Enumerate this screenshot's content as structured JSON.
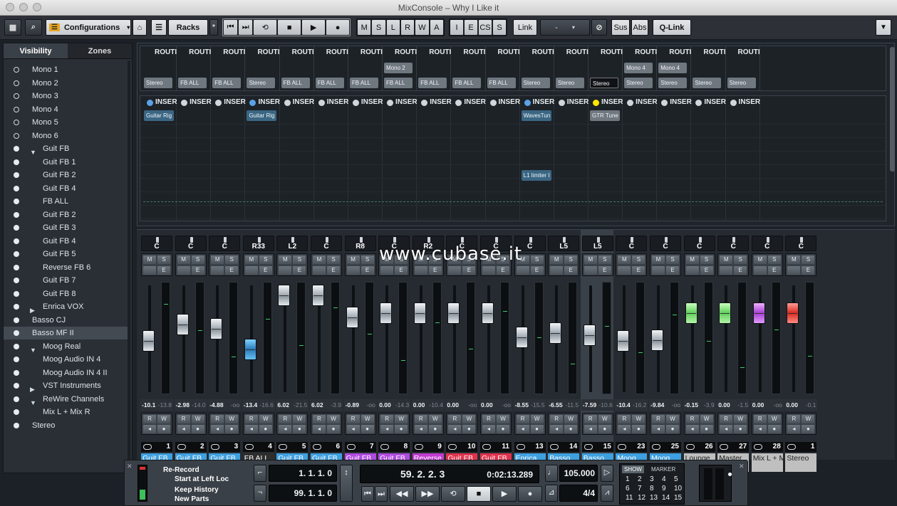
{
  "window": {
    "title": "MixConsole – Why I Like it"
  },
  "toolbar": {
    "configurations_label": "Configurations",
    "racks_label": "Racks",
    "racks_star": "*",
    "msl_keys": [
      "M",
      "S",
      "L",
      "R",
      "W",
      "A"
    ],
    "iecs_keys": [
      "I",
      "E",
      "CS",
      "S"
    ],
    "link_label": "Link",
    "link_value": "-",
    "sus_label": "Sus",
    "abs_label": "Abs",
    "qlink_label": "Q-Link"
  },
  "sidebar": {
    "tabs": [
      "Visibility",
      "Zones"
    ],
    "items": [
      {
        "label": "Mono 1",
        "level": 0,
        "dot": "empty",
        "tri": ""
      },
      {
        "label": "Mono 2",
        "level": 0,
        "dot": "empty",
        "tri": ""
      },
      {
        "label": "Mono 3",
        "level": 0,
        "dot": "empty",
        "tri": ""
      },
      {
        "label": "Mono 4",
        "level": 0,
        "dot": "empty",
        "tri": ""
      },
      {
        "label": "Mono 5",
        "level": 0,
        "dot": "empty",
        "tri": ""
      },
      {
        "label": "Mono 6",
        "level": 0,
        "dot": "empty",
        "tri": ""
      },
      {
        "label": "Guit FB",
        "level": 1,
        "dot": "filled",
        "tri": "open"
      },
      {
        "label": "Guit FB 1",
        "level": 2,
        "dot": "filled",
        "tri": ""
      },
      {
        "label": "Guit FB 2",
        "level": 2,
        "dot": "filled",
        "tri": ""
      },
      {
        "label": "Guit FB 4",
        "level": 2,
        "dot": "filled",
        "tri": ""
      },
      {
        "label": "FB ALL",
        "level": 2,
        "dot": "filled",
        "tri": ""
      },
      {
        "label": "Guit FB 2",
        "level": 2,
        "dot": "filled",
        "tri": ""
      },
      {
        "label": "Guit FB 3",
        "level": 2,
        "dot": "filled",
        "tri": ""
      },
      {
        "label": "Guit FB 4",
        "level": 2,
        "dot": "filled",
        "tri": ""
      },
      {
        "label": "Guit FB 5",
        "level": 2,
        "dot": "filled",
        "tri": ""
      },
      {
        "label": "Reverse FB 6",
        "level": 2,
        "dot": "filled",
        "tri": ""
      },
      {
        "label": "Guit FB 7",
        "level": 2,
        "dot": "filled",
        "tri": ""
      },
      {
        "label": "Guit FB 8",
        "level": 2,
        "dot": "filled",
        "tri": ""
      },
      {
        "label": "Enrica VOX",
        "level": 1,
        "dot": "filled",
        "tri": "closed"
      },
      {
        "label": "Basso CJ",
        "level": 0,
        "dot": "filled",
        "tri": ""
      },
      {
        "label": "Basso MF II",
        "level": 0,
        "dot": "filled",
        "tri": "",
        "selected": true
      },
      {
        "label": "Moog Real",
        "level": 1,
        "dot": "filled",
        "tri": "open"
      },
      {
        "label": "Moog Audio IN 4",
        "level": 2,
        "dot": "filled",
        "tri": ""
      },
      {
        "label": "Moog Audio IN 4 II",
        "level": 2,
        "dot": "filled",
        "tri": ""
      },
      {
        "label": "VST Instruments",
        "level": 1,
        "dot": "filled",
        "tri": "closed"
      },
      {
        "label": "ReWire Channels",
        "level": 1,
        "dot": "filled",
        "tri": "open"
      },
      {
        "label": "Mix  L + Mix  R",
        "level": 2,
        "dot": "filled",
        "tri": ""
      },
      {
        "label": "Stereo",
        "level": 0,
        "dot": "filled",
        "tri": ""
      }
    ]
  },
  "rack": {
    "routing_header": "ROUTI",
    "insert_header": "INSER",
    "routing_mid": {
      "7": "Mono 2",
      "14": "Mono 4",
      "15": "Mono 4"
    },
    "routing_out": {
      "0": "Stereo",
      "1": "FB ALL",
      "2": "FB ALL",
      "3": "Stereo",
      "4": "FB ALL",
      "5": "FB ALL",
      "6": "FB ALL",
      "7": "FB ALL",
      "8": "FB ALL",
      "9": "FB ALL",
      "10": "FB ALL",
      "11": "Stereo",
      "12": "Stereo",
      "13": "Stereo",
      "14": "Stereo",
      "15": "Stereo",
      "16": "Stereo",
      "17": "Stereo"
    },
    "inserts": [
      {
        "ch": 0,
        "row": 0,
        "label": "Guitar Rig"
      },
      {
        "ch": 3,
        "row": 0,
        "label": "Guitar Rig"
      },
      {
        "ch": 11,
        "row": 0,
        "label": "WavesTun"
      },
      {
        "ch": 11,
        "row": 4,
        "label": "L1 limiter I"
      },
      {
        "ch": 13,
        "row": 0,
        "label": "GTR Tune",
        "gray": true
      }
    ],
    "insert_dot_colors": {
      "0": "#5aa2e6",
      "3": "#5aa2e6",
      "11": "#5aa2e6",
      "13": "#ffe600"
    }
  },
  "watermark": "www.cubase.it",
  "channels": [
    {
      "pan": "C",
      "v1": "-10.1",
      "v2": "-13.8",
      "num": "1",
      "name": "Guit FB",
      "color": "#3fa0e0",
      "fader": 0.53,
      "ftype": "normal"
    },
    {
      "pan": "C",
      "v1": "-2.98",
      "v2": "-14.0",
      "num": "2",
      "name": "Guit FB",
      "color": "#3fa0e0",
      "fader": 0.36,
      "ftype": "normal"
    },
    {
      "pan": "C",
      "v1": "-4.88",
      "v2": "-oo",
      "num": "3",
      "name": "Guit FB",
      "color": "#3fa0e0",
      "fader": 0.4,
      "ftype": "normal"
    },
    {
      "pan": "R33",
      "v1": "-13.4",
      "v2": "-16.6",
      "num": "4",
      "name": "FB ALL",
      "color": "#2e2e2e",
      "fader": 0.62,
      "ftype": "blue"
    },
    {
      "pan": "L2",
      "v1": "6.02",
      "v2": "-21.5",
      "num": "5",
      "name": "Guit FB",
      "color": "#3fa0e0",
      "fader": 0.05,
      "ftype": "normal"
    },
    {
      "pan": "C",
      "v1": "6.02",
      "v2": "-3.9",
      "num": "6",
      "name": "Guit FB",
      "color": "#3fa0e0",
      "fader": 0.05,
      "ftype": "normal"
    },
    {
      "pan": "R8",
      "v1": "-0.89",
      "v2": "-oo",
      "num": "7",
      "name": "Guit FB",
      "color": "#b04ae0",
      "fader": 0.28,
      "ftype": "normal"
    },
    {
      "pan": "C",
      "v1": "0.00",
      "v2": "-14.3",
      "num": "8",
      "name": "Guit FB",
      "color": "#b04ae0",
      "fader": 0.24,
      "ftype": "normal"
    },
    {
      "pan": "R2",
      "v1": "0.00",
      "v2": "-10.4",
      "num": "9",
      "name": "Reverse",
      "color": "#c03bd0",
      "fader": 0.24,
      "ftype": "normal"
    },
    {
      "pan": "C",
      "v1": "0.00",
      "v2": "-oo",
      "num": "10",
      "name": "Guit FB",
      "color": "#e0334d",
      "fader": 0.24,
      "ftype": "normal"
    },
    {
      "pan": "C",
      "v1": "0.00",
      "v2": "-oo",
      "num": "11",
      "name": "Guit FB",
      "color": "#e0334d",
      "fader": 0.24,
      "ftype": "normal"
    },
    {
      "pan": "C",
      "v1": "-8.55",
      "v2": "-15.5",
      "num": "13",
      "name": "Enrica",
      "color": "#3fa0e0",
      "fader": 0.49,
      "ftype": "normal"
    },
    {
      "pan": "L5",
      "v1": "-6.55",
      "v2": "-11.5",
      "num": "14",
      "name": "Basso",
      "color": "#3fa0e0",
      "fader": 0.45,
      "ftype": "normal"
    },
    {
      "pan": "L5",
      "v1": "-7.59",
      "v2": "-10.6",
      "num": "15",
      "name": "Basso",
      "color": "#3fa0e0",
      "fader": 0.47,
      "ftype": "normal",
      "selected": true
    },
    {
      "pan": "C",
      "v1": "-10.4",
      "v2": "-16.2",
      "num": "23",
      "name": "Moog",
      "color": "#3fa0e0",
      "fader": 0.53,
      "ftype": "normal"
    },
    {
      "pan": "C",
      "v1": "-9.84",
      "v2": "-oo",
      "num": "25",
      "name": "Moog",
      "color": "#3fa0e0",
      "fader": 0.52,
      "ftype": "normal"
    },
    {
      "pan": "C",
      "v1": "-0.15",
      "v2": "-3.9",
      "num": "26",
      "name": "Lounge",
      "color": "#bfbfbf",
      "fader": 0.24,
      "ftype": "green"
    },
    {
      "pan": "C",
      "v1": "0.00",
      "v2": "-1.5",
      "num": "27",
      "name": "Master",
      "color": "#bfbfbf",
      "fader": 0.24,
      "ftype": "green"
    },
    {
      "pan": "C",
      "v1": "0.00",
      "v2": "-oo",
      "num": "28",
      "name": "Mix L + Mix R",
      "color": "#bfbfbf",
      "fader": 0.24,
      "ftype": "purple"
    },
    {
      "pan": "C",
      "v1": "0.00",
      "v2": "-0.1",
      "num": "1",
      "name": "Stereo",
      "color": "#bfbfbf",
      "fader": 0.24,
      "ftype": "red"
    }
  ],
  "transport": {
    "rec_mode_1": "Re-Record",
    "rec_mode_2": "Start at Left Loc",
    "rec_mode_3": "Keep History",
    "rec_mode_4": "New Parts",
    "left_locator": "1. 1. 1.   0",
    "right_locator": "99. 1. 1.   0",
    "position_bars": "59. 2. 2.   3",
    "position_time": "0:02:13.289",
    "tempo": "105.000",
    "signature": "4/4",
    "show_label": "SHOW",
    "marker_label": "MARKER",
    "markers": [
      "1",
      "2",
      "3",
      "4",
      "5",
      "6",
      "7",
      "8",
      "9",
      "10",
      "11",
      "12",
      "13",
      "14",
      "15"
    ]
  }
}
